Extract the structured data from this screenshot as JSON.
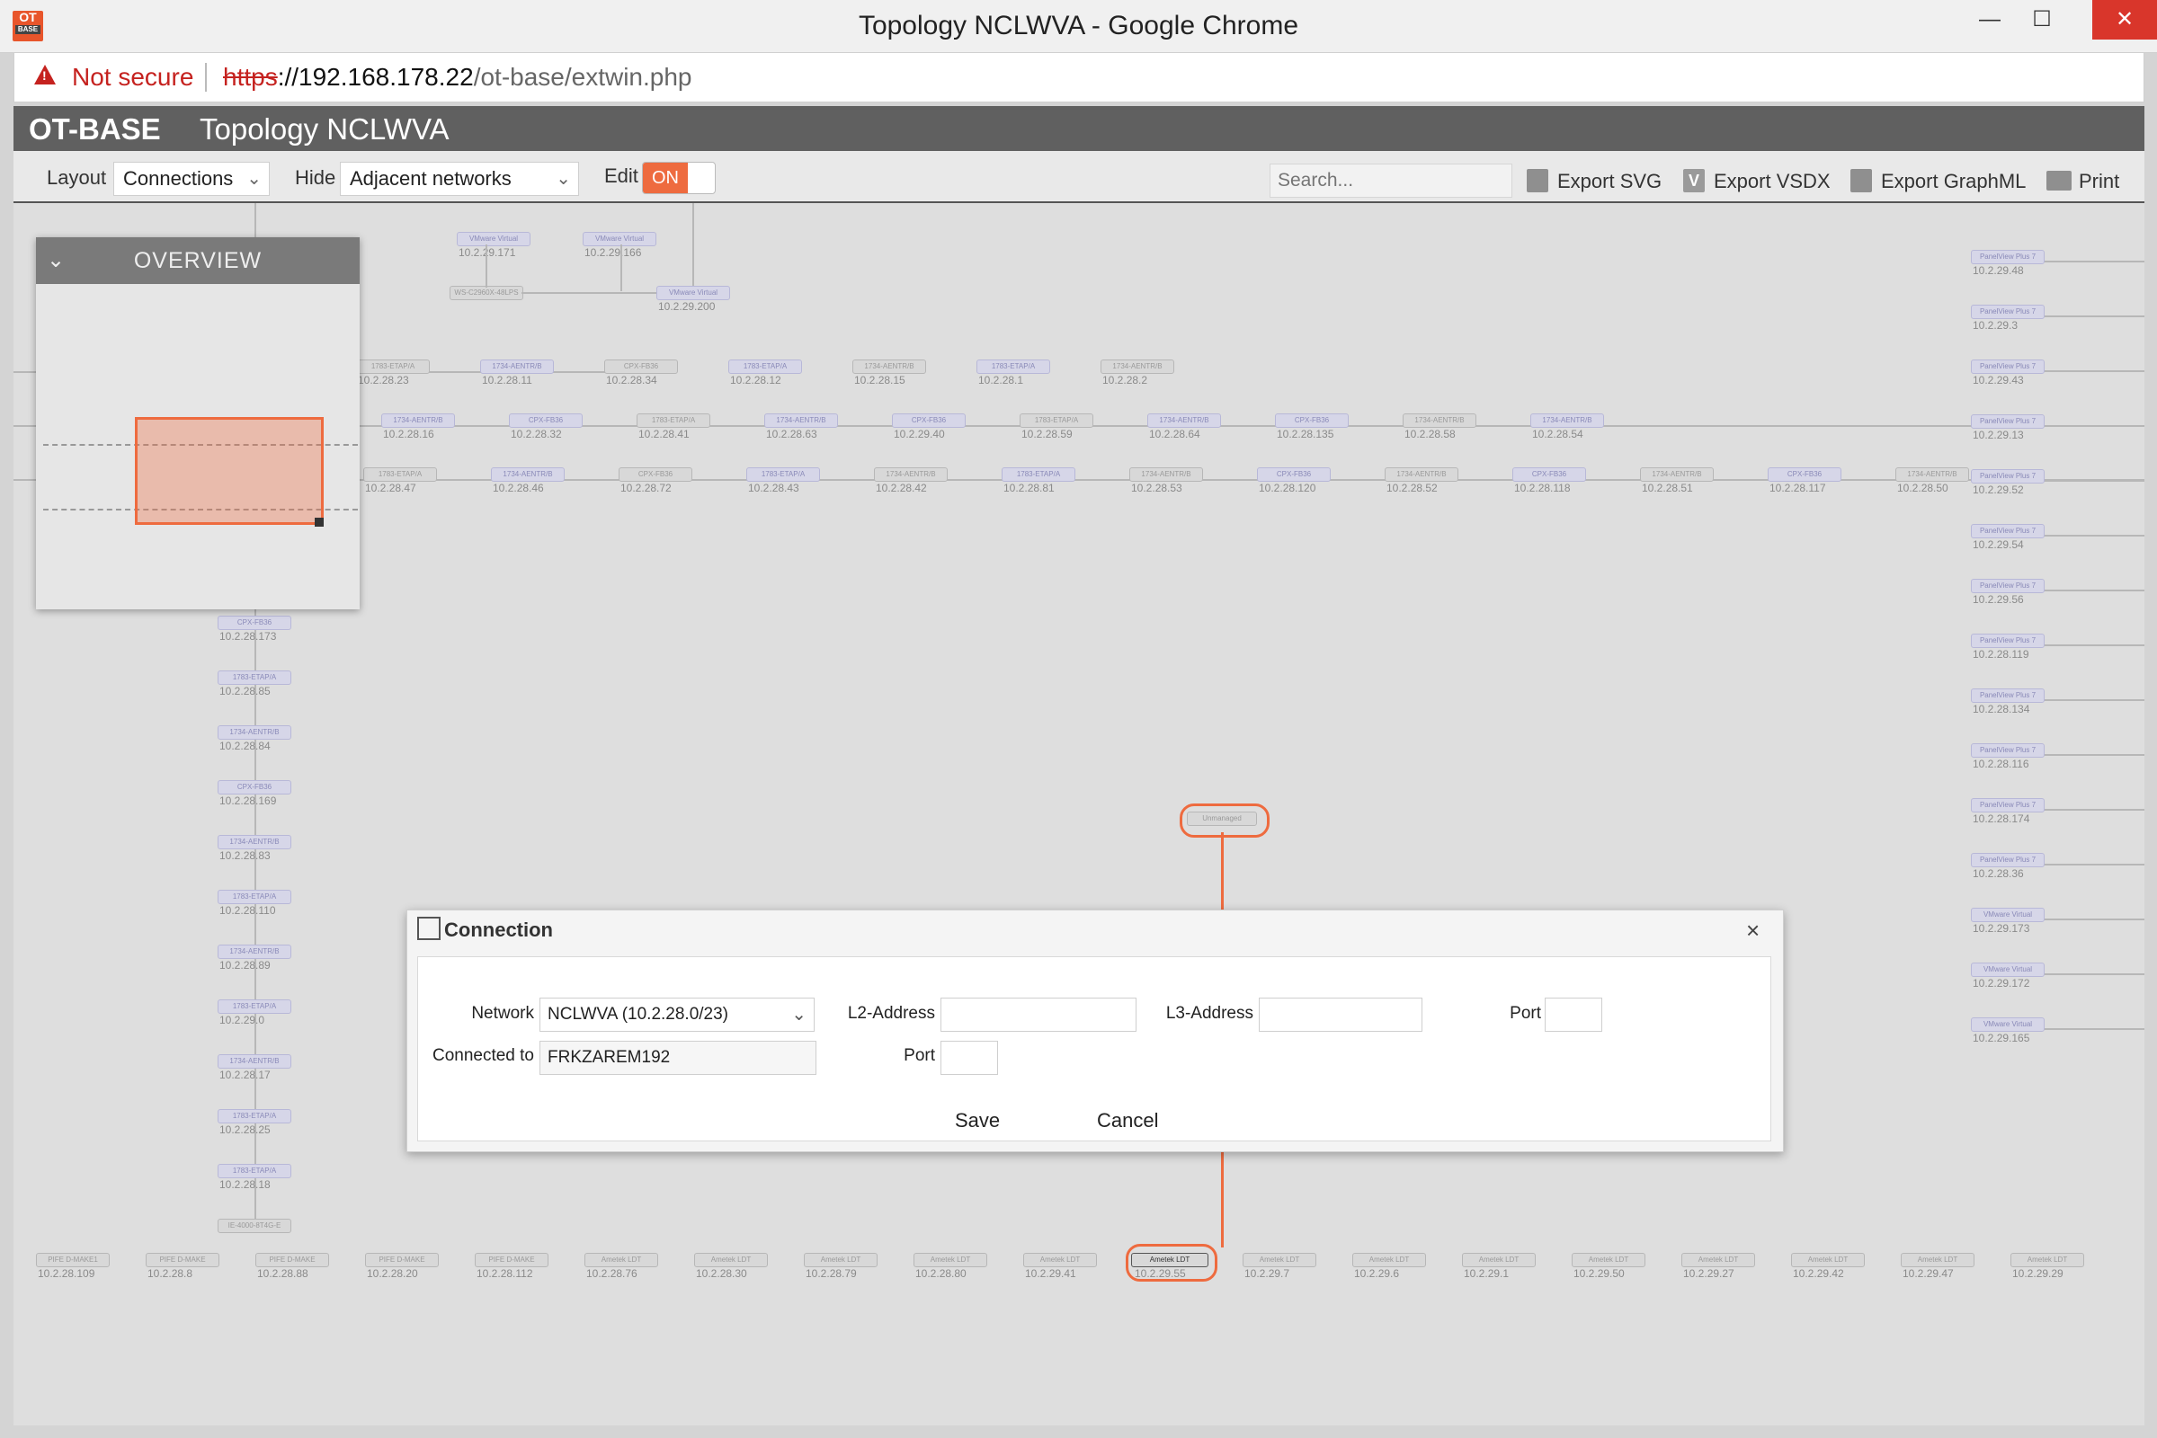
{
  "window": {
    "title": "Topology NCLWVA - Google Chrome",
    "logo_top": "OT",
    "logo_bottom": "BASE",
    "min_glyph": "—",
    "max_glyph": "☐",
    "close_glyph": "✕"
  },
  "addressbar": {
    "security_label": "Not secure",
    "url_protocol": "https",
    "url_host": "://192.168.178.22",
    "url_path": "/ot-base/extwin.php"
  },
  "header": {
    "brand": "OT-BASE",
    "title": "Topology NCLWVA"
  },
  "toolbar": {
    "layout_label": "Layout",
    "layout_value": "Connections",
    "hide_label": "Hide",
    "hide_value": "Adjacent networks",
    "edit_label": "Edit",
    "edit_toggle": "ON",
    "search_placeholder": "Search...",
    "export_svg": "Export SVG",
    "export_vsdx": "Export VSDX",
    "export_vsdx_icon_glyph": "V",
    "export_graphml": "Export GraphML",
    "print": "Print"
  },
  "overview": {
    "title": "OVERVIEW"
  },
  "topology": {
    "row_top": [
      {
        "label": "VMware Virtual",
        "ip": "10.2.29.171"
      },
      {
        "label": "VMware Virtual",
        "ip": "10.2.29.166"
      },
      {
        "label": "WS-C2960X-48LPS",
        "ip": ""
      },
      {
        "label": "VMware Virtual",
        "ip": "10.2.29.200"
      }
    ],
    "row1": [
      {
        "label": "1783-ETAP/A",
        "ip": "10.2.28.23"
      },
      {
        "label": "1734-AENTR/B",
        "ip": "10.2.28.11"
      },
      {
        "label": "CPX-FB36",
        "ip": "10.2.28.34"
      },
      {
        "label": "1783-ETAP/A",
        "ip": "10.2.28.12"
      },
      {
        "label": "1734-AENTR/B",
        "ip": "10.2.28.15"
      },
      {
        "label": "1783-ETAP/A",
        "ip": "10.2.28.1"
      },
      {
        "label": "1734-AENTR/B",
        "ip": "10.2.28.2"
      }
    ],
    "row2": [
      {
        "label": "1734-AENTR/B",
        "ip": "10.2.28.16"
      },
      {
        "label": "CPX-FB36",
        "ip": "10.2.28.32"
      },
      {
        "label": "1783-ETAP/A",
        "ip": "10.2.28.41"
      },
      {
        "label": "1734-AENTR/B",
        "ip": "10.2.28.63"
      },
      {
        "label": "CPX-FB36",
        "ip": "10.2.29.40"
      },
      {
        "label": "1783-ETAP/A",
        "ip": "10.2.28.59"
      },
      {
        "label": "1734-AENTR/B",
        "ip": "10.2.28.64"
      },
      {
        "label": "CPX-FB36",
        "ip": "10.2.28.135"
      },
      {
        "label": "1734-AENTR/B",
        "ip": "10.2.28.58"
      },
      {
        "label": "1734-AENTR/B",
        "ip": "10.2.28.54"
      }
    ],
    "row3": [
      {
        "label": "1783-ETAP/A",
        "ip": "10.2.28.47"
      },
      {
        "label": "1734-AENTR/B",
        "ip": "10.2.28.46"
      },
      {
        "label": "CPX-FB36",
        "ip": "10.2.28.72"
      },
      {
        "label": "1783-ETAP/A",
        "ip": "10.2.28.43"
      },
      {
        "label": "1734-AENTR/B",
        "ip": "10.2.28.42"
      },
      {
        "label": "1783-ETAP/A",
        "ip": "10.2.28.81"
      },
      {
        "label": "1734-AENTR/B",
        "ip": "10.2.28.53"
      },
      {
        "label": "CPX-FB36",
        "ip": "10.2.28.120"
      },
      {
        "label": "1734-AENTR/B",
        "ip": "10.2.28.52"
      },
      {
        "label": "CPX-FB36",
        "ip": "10.2.28.118"
      },
      {
        "label": "1734-AENTR/B",
        "ip": "10.2.28.51"
      },
      {
        "label": "CPX-FB36",
        "ip": "10.2.28.117"
      },
      {
        "label": "1734-AENTR/B",
        "ip": "10.2.28.50"
      }
    ],
    "left_column": [
      {
        "label": "CPX-FB36",
        "ip": "10.2.28.173"
      },
      {
        "label": "1783-ETAP/A",
        "ip": "10.2.28.85"
      },
      {
        "label": "1734-AENTR/B",
        "ip": "10.2.28.84"
      },
      {
        "label": "CPX-FB36",
        "ip": "10.2.28.169"
      },
      {
        "label": "1734-AENTR/B",
        "ip": "10.2.28.83"
      },
      {
        "label": "1783-ETAP/A",
        "ip": "10.2.28.110"
      },
      {
        "label": "1734-AENTR/B",
        "ip": "10.2.28.89"
      },
      {
        "label": "1783-ETAP/A",
        "ip": "10.2.29.0"
      },
      {
        "label": "1734-AENTR/B",
        "ip": "10.2.28.17"
      },
      {
        "label": "1783-ETAP/A",
        "ip": "10.2.28.25"
      },
      {
        "label": "1783-ETAP/A",
        "ip": "10.2.28.18"
      },
      {
        "label": "IE-4000-8T4G-E",
        "ip": ""
      }
    ],
    "right_column": [
      {
        "label": "PanelView Plus 7",
        "ip": "10.2.29.48"
      },
      {
        "label": "PanelView Plus 7",
        "ip": "10.2.29.3"
      },
      {
        "label": "PanelView Plus 7",
        "ip": "10.2.29.43"
      },
      {
        "label": "PanelView Plus 7",
        "ip": "10.2.29.13"
      },
      {
        "label": "PanelView Plus 7",
        "ip": "10.2.29.52"
      },
      {
        "label": "PanelView Plus 7",
        "ip": "10.2.29.54"
      },
      {
        "label": "PanelView Plus 7",
        "ip": "10.2.29.56"
      },
      {
        "label": "PanelView Plus 7",
        "ip": "10.2.28.119"
      },
      {
        "label": "PanelView Plus 7",
        "ip": "10.2.28.134"
      },
      {
        "label": "PanelView Plus 7",
        "ip": "10.2.28.116"
      },
      {
        "label": "PanelView Plus 7",
        "ip": "10.2.28.174"
      },
      {
        "label": "PanelView Plus 7",
        "ip": "10.2.28.36"
      },
      {
        "label": "VMware Virtual",
        "ip": "10.2.29.173"
      },
      {
        "label": "VMware Virtual",
        "ip": "10.2.29.172"
      },
      {
        "label": "VMware Virtual",
        "ip": "10.2.29.165"
      }
    ],
    "bottom_row": [
      {
        "label": "PIFE D-MAKE1",
        "ip": "10.2.28.109"
      },
      {
        "label": "PIFE D-MAKE",
        "ip": "10.2.28.8"
      },
      {
        "label": "PIFE D-MAKE",
        "ip": "10.2.28.88"
      },
      {
        "label": "PIFE D-MAKE",
        "ip": "10.2.28.20"
      },
      {
        "label": "PIFE D-MAKE",
        "ip": "10.2.28.112"
      },
      {
        "label": "Ametek LDT",
        "ip": "10.2.28.76"
      },
      {
        "label": "Ametek LDT",
        "ip": "10.2.28.30"
      },
      {
        "label": "Ametek LDT",
        "ip": "10.2.28.79"
      },
      {
        "label": "Ametek LDT",
        "ip": "10.2.28.80"
      },
      {
        "label": "Ametek LDT",
        "ip": "10.2.29.41"
      },
      {
        "label": "Ametek LDT",
        "ip": "10.2.29.55"
      },
      {
        "label": "Ametek LDT",
        "ip": "10.2.29.7"
      },
      {
        "label": "Ametek LDT",
        "ip": "10.2.29.6"
      },
      {
        "label": "Ametek LDT",
        "ip": "10.2.29.1"
      },
      {
        "label": "Ametek LDT",
        "ip": "10.2.29.50"
      },
      {
        "label": "Ametek LDT",
        "ip": "10.2.29.27"
      },
      {
        "label": "Ametek LDT",
        "ip": "10.2.29.42"
      },
      {
        "label": "Ametek LDT",
        "ip": "10.2.29.47"
      },
      {
        "label": "Ametek LDT",
        "ip": "10.2.29.29"
      }
    ],
    "selected_unmanaged": {
      "label": "Unmanaged"
    },
    "selected_endpoint": {
      "label": "Ametek LDT",
      "ip": "10.2.29.55"
    },
    "accent_color": "#ee6b3f"
  },
  "dialog": {
    "title": "Connection",
    "close_glyph": "×",
    "network_label": "Network",
    "network_value": "NCLWVA (10.2.28.0/23)",
    "connected_to_label": "Connected to",
    "connected_to_value": "FRKZAREM192",
    "l2_label": "L2-Address",
    "l2_value": "",
    "port_left_label": "Port",
    "port_left_value": "",
    "l3_label": "L3-Address",
    "l3_value": "",
    "port_right_label": "Port",
    "port_right_value": "",
    "save": "Save",
    "cancel": "Cancel"
  }
}
